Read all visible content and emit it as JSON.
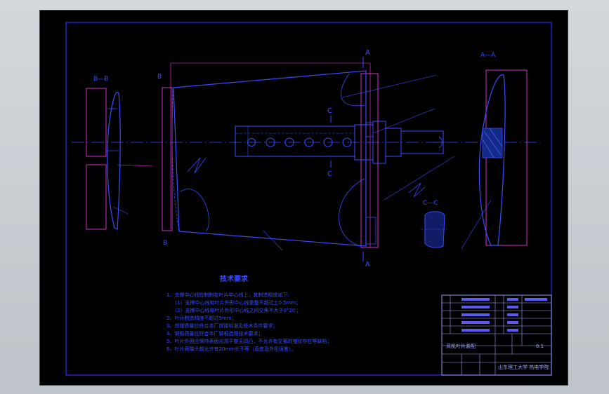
{
  "section_labels": {
    "a_top": "A",
    "a_bottom": "A",
    "c_top": "C",
    "c_bottom": "C",
    "b_top": "B",
    "b_bottom": "B",
    "view_aa": "A—A",
    "view_bb": "B—B",
    "view_cc": "C—C"
  },
  "tech_requirements": {
    "title": "技术要求",
    "lines": [
      "1、支撑中心线应制制在叶片中心线上，其制造精度如下:",
      "（1）支撑中心线和叶片外形中心线重整不超过土0.5mm；",
      "（2）支撑中心线和叶片外形中心线之间交角不大于0°20′；",
      "2、叶片制造精度不超过5mm；",
      "3、焊缝质量应符合本厂焊接标准及技术条件要求；",
      "4、钢板质量应符合本厂钢板选用技术要求；",
      "5、叶片外面应保持表面光滑平整无凹凸，不允许有显著的皱纹存在等缺陷；",
      "6、叶片两端头部允许有20mm长不等（直度及外形误差）。"
    ]
  },
  "title_block": {
    "drawing_name": "风机叶片装配",
    "scale_value": "0.1",
    "school": "山东理工大学 热电学院"
  }
}
